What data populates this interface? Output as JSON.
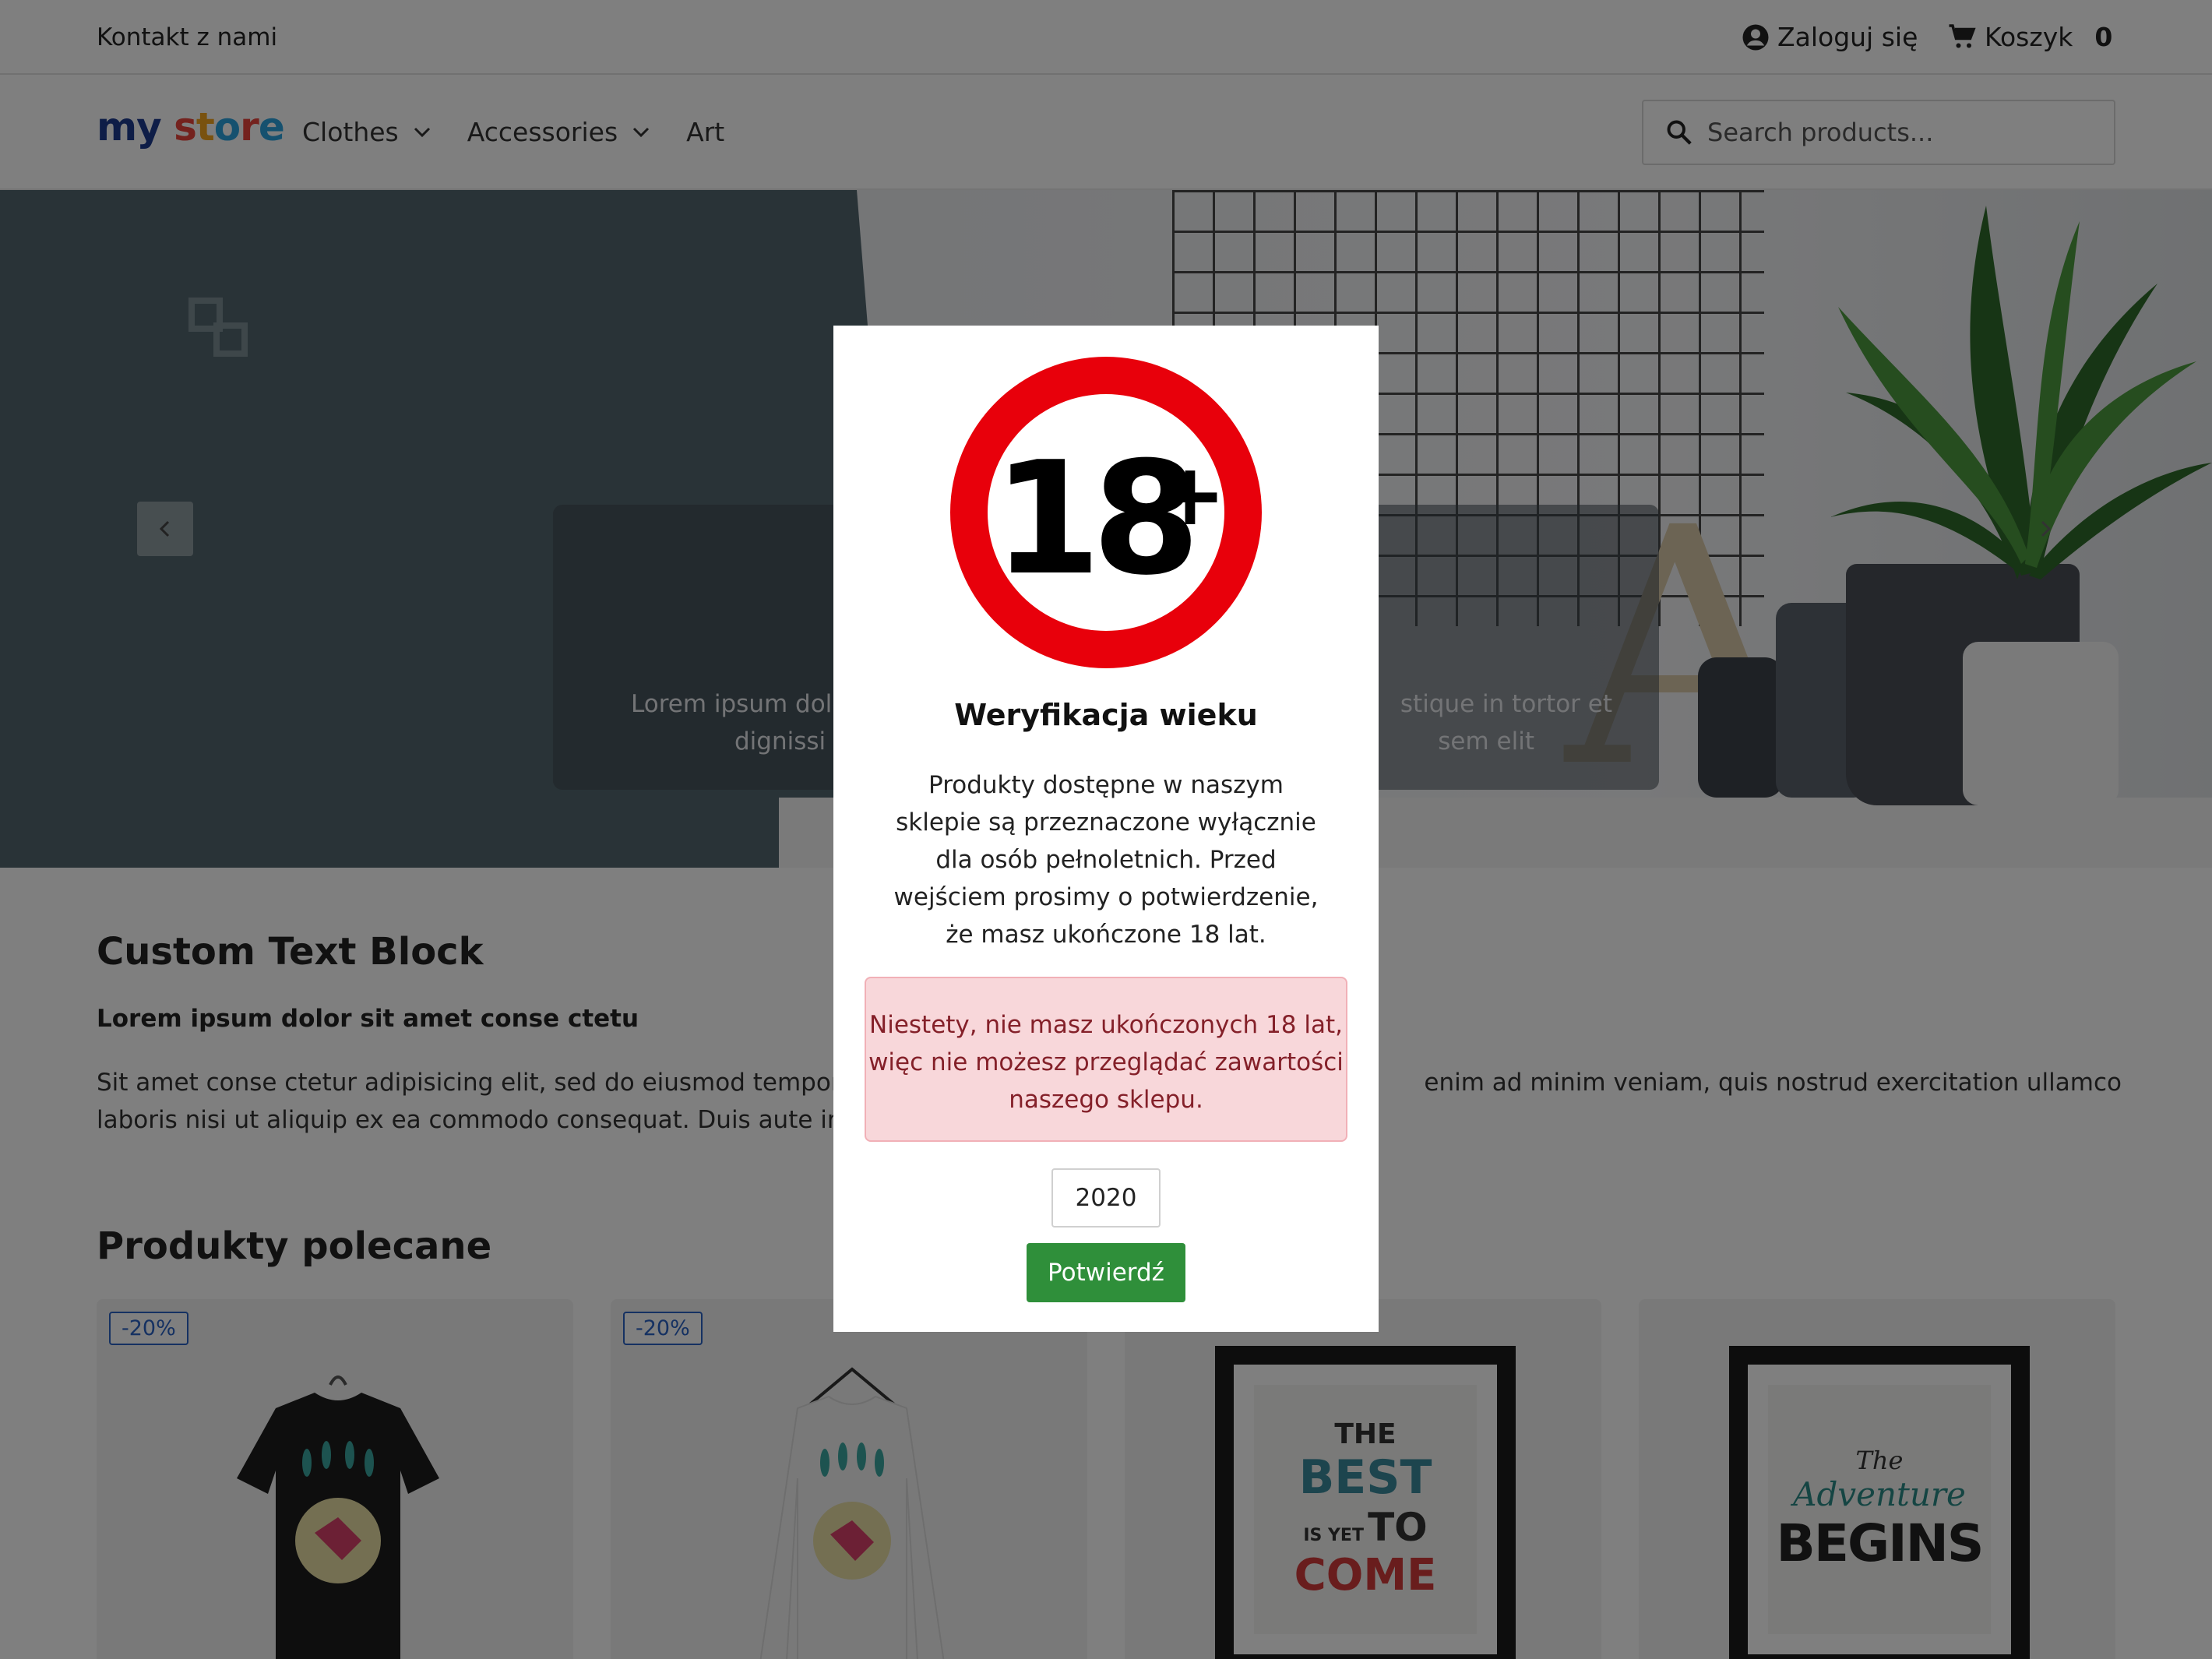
{
  "topbar": {
    "contact": "Kontakt z nami",
    "login": "Zaloguj się",
    "cart_label": "Koszyk",
    "cart_count": "0"
  },
  "header": {
    "logo": [
      "my",
      "s",
      "t",
      "o",
      "r",
      "e"
    ],
    "nav": [
      {
        "label": "Clothes",
        "has_dropdown": true
      },
      {
        "label": "Accessories",
        "has_dropdown": true
      },
      {
        "label": "Art",
        "has_dropdown": false
      }
    ],
    "search_placeholder": "Search products..."
  },
  "hero": {
    "caption_left": "Lorem ipsum dolo",
    "caption_left2": "dignissi",
    "caption_right": "stique in tortor et",
    "caption_right2": "sem elit"
  },
  "content": {
    "custom_title": "Custom Text Block",
    "custom_subtitle": "Lorem ipsum dolor sit amet conse ctetu",
    "custom_body_left": "Sit amet conse ctetur adipisicing elit, sed do eiusmod tempor in",
    "custom_body_left2": "laboris nisi ut aliquip ex ea commodo consequat. Duis aute irur",
    "custom_body_right": "enim ad minim veniam, quis nostrud exercitation ullamco",
    "products_title": "Produkty polecane"
  },
  "products": [
    {
      "badge": "-20%"
    },
    {
      "badge": "-20%"
    },
    {
      "poster_lines": [
        "THE",
        "BEST",
        "IS YET",
        "TO",
        "COME"
      ]
    },
    {
      "poster_lines": [
        "The",
        "Adventure",
        "BEGINS"
      ]
    }
  ],
  "modal": {
    "sign_text": "18",
    "sign_plus": "+",
    "title": "Weryfikacja wieku",
    "description": "Produkty dostępne w naszym sklepie są przeznaczone wyłącznie dla osób pełnoletnich. Przed wejściem prosimy o potwierdzenie, że masz ukończone 18 lat.",
    "error": "Niestety, nie masz ukończonych 18 lat, więc nie możesz przeglądać zawartości naszego sklepu.",
    "year_value": "2020",
    "confirm_label": "Potwierdź"
  },
  "colors": {
    "sign_red": "#e8000b",
    "confirm_green": "#2f8f3a",
    "alert_bg": "#f8d7da",
    "badge_blue": "#2a63c4"
  }
}
